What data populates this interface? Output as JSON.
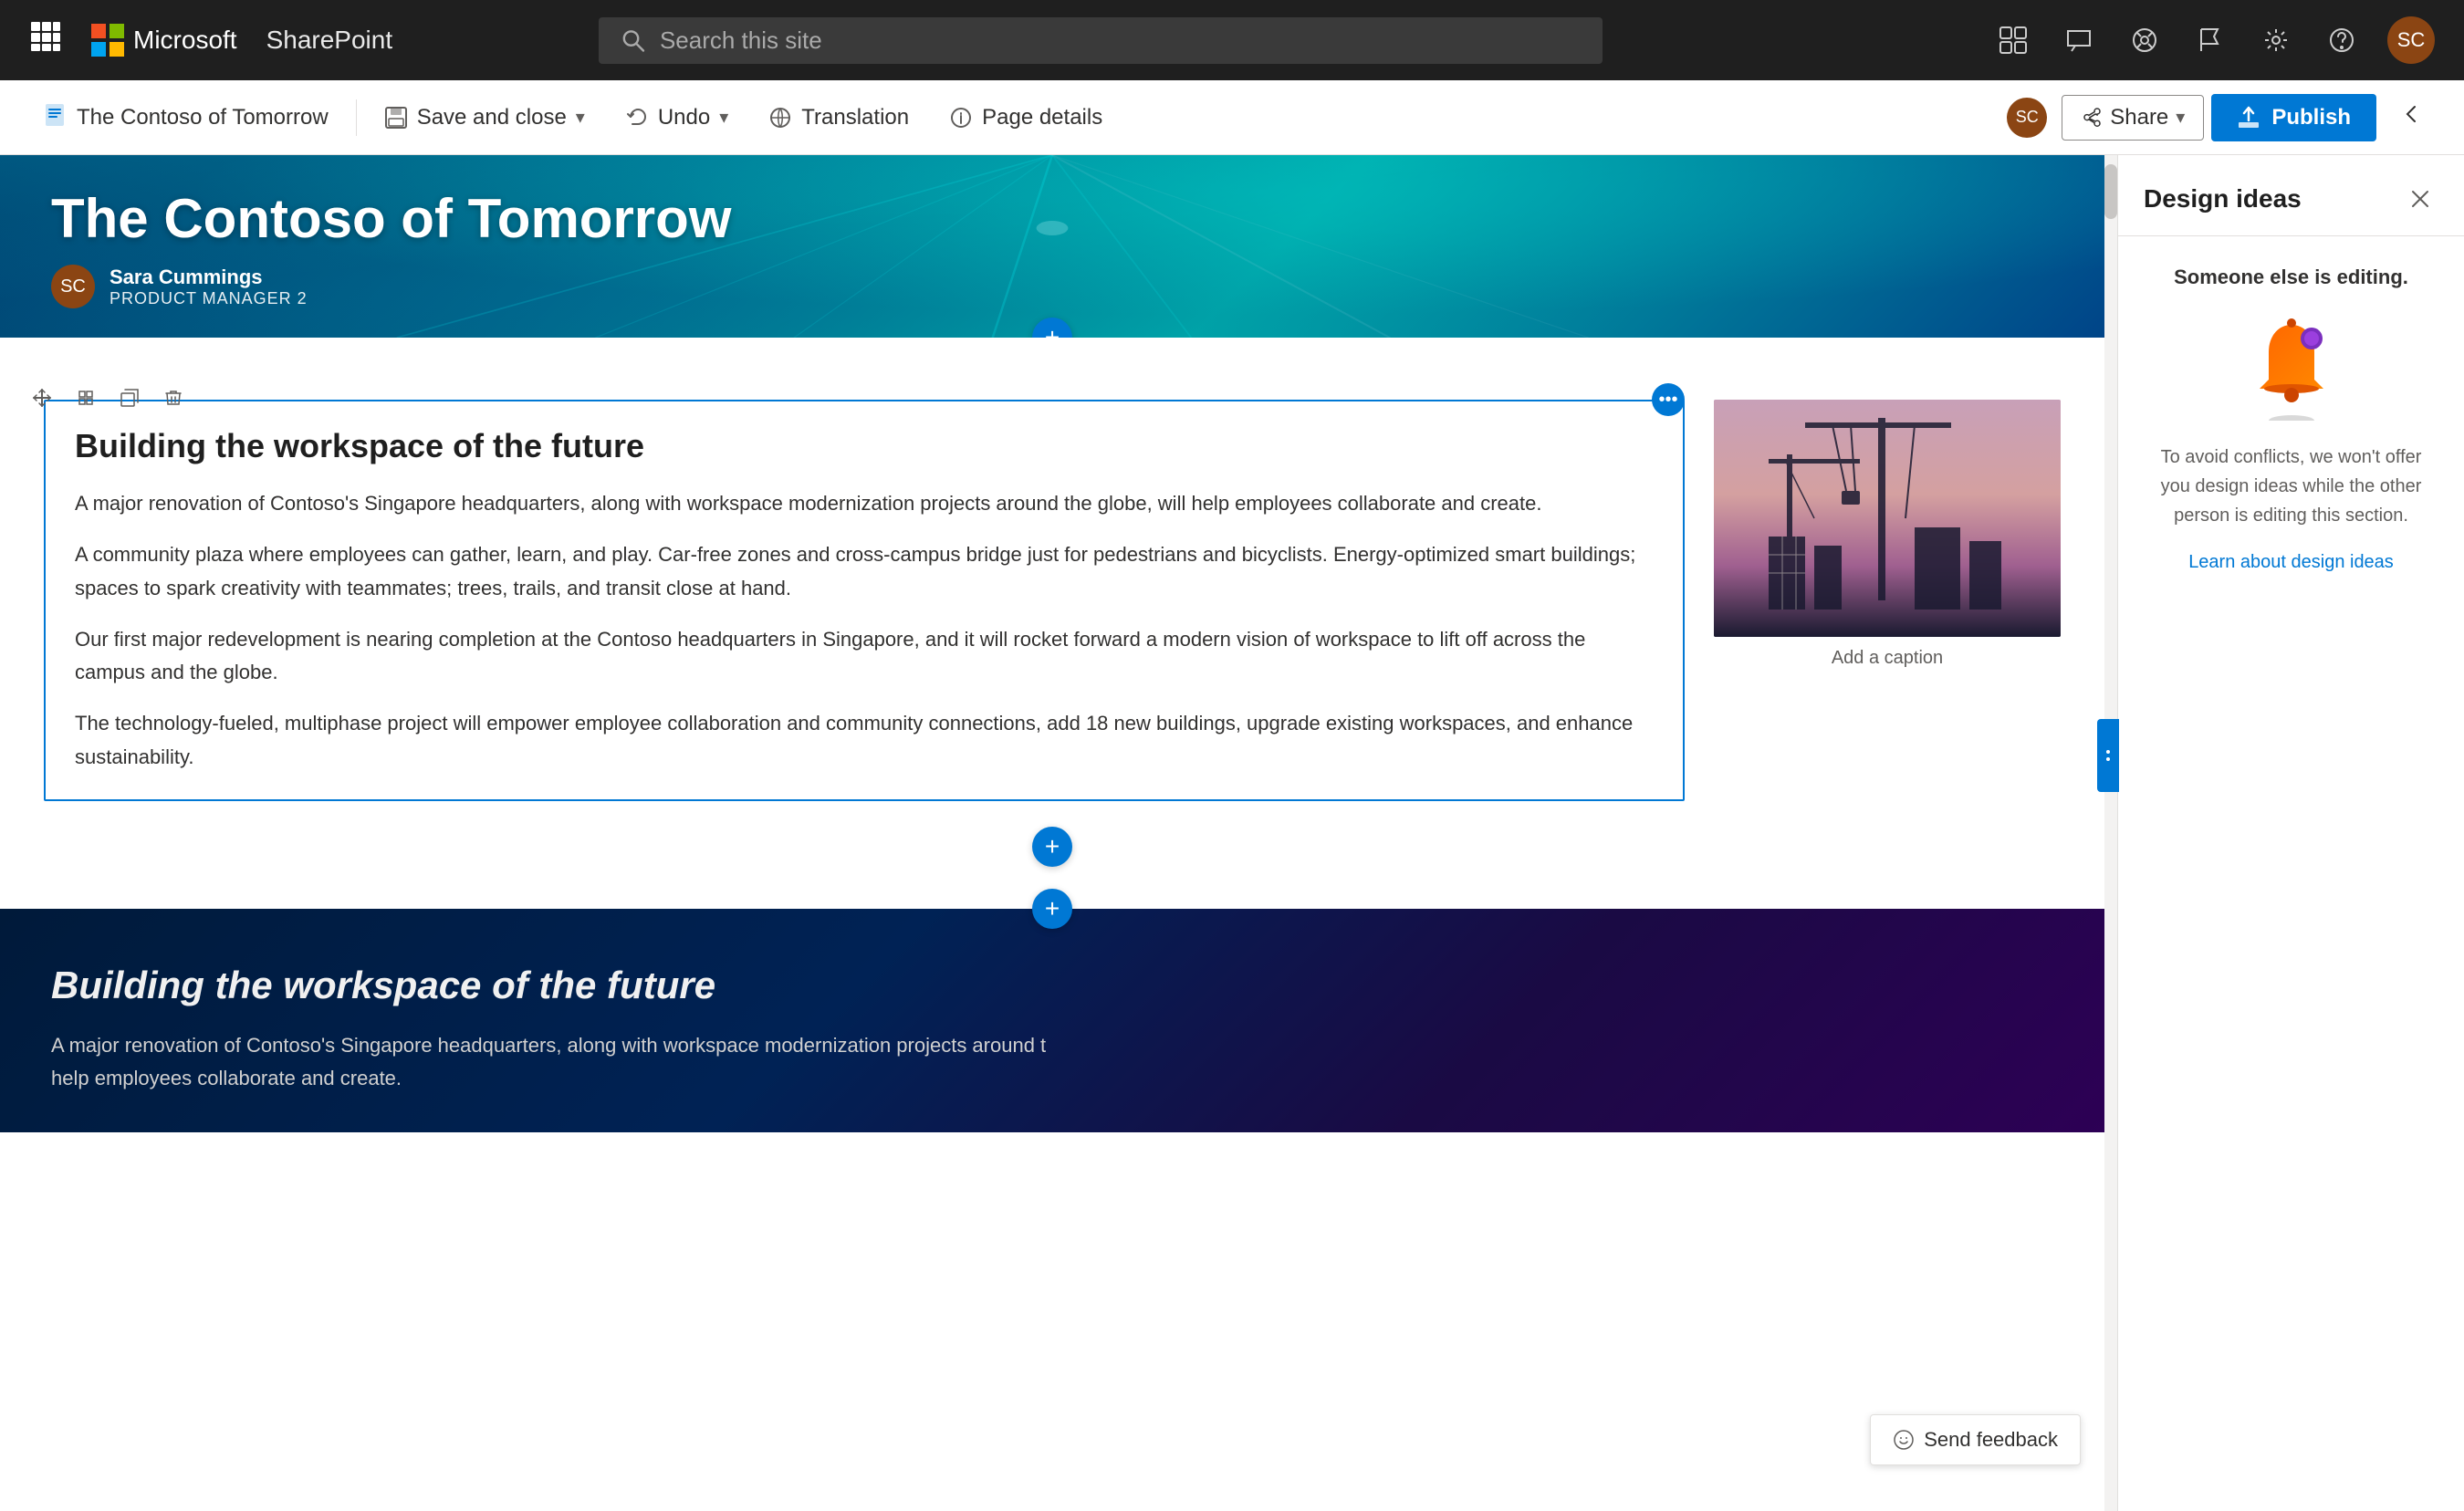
{
  "app": {
    "name": "Microsoft",
    "product": "SharePoint"
  },
  "search": {
    "placeholder": "Search this site"
  },
  "toolbar": {
    "page_label": "The Contoso of Tomorrow",
    "save_close_label": "Save and close",
    "undo_label": "Undo",
    "translation_label": "Translation",
    "page_details_label": "Page details",
    "share_label": "Share",
    "publish_label": "Publish"
  },
  "hero": {
    "title": "The Contoso of Tomorrow",
    "author_name": "Sara Cummings",
    "author_role": "PRODUCT MANAGER 2",
    "avatar_initials": "SC"
  },
  "content": {
    "section1": {
      "heading": "Building the workspace of the future",
      "paragraph1": "A major renovation of Contoso's Singapore headquarters, along with workspace modernization projects around the globe, will help employees collaborate and create.",
      "paragraph2": "A community plaza where employees can gather, learn, and play. Car-free zones and cross-campus bridge just for pedestrians and bicyclists. Energy-optimized smart buildings; spaces to spark creativity with teammates; trees, trails, and transit close at hand.",
      "paragraph3": "Our first major redevelopment is nearing completion at the Contoso headquarters in Singapore, and it will rocket forward a modern vision of workspace to lift off across the campus and the globe.",
      "paragraph4": "The technology-fueled, multiphase project will empower employee collaboration and community connections, add 18 new buildings, upgrade existing workspaces, and enhance sustainability.",
      "image_caption": "Add a caption"
    },
    "section2": {
      "heading": "Building the workspace of the future",
      "paragraph1": "A major renovation of Contoso's Singapore headquarters, along with workspace modernization projects around t",
      "paragraph2": "help employees collaborate and create."
    }
  },
  "design_panel": {
    "title": "Design ideas",
    "subtitle": "Someone else is editing.",
    "description": "To avoid conflicts, we won't offer you design ideas while the other person is editing this section.",
    "link_text": "Learn about design ideas"
  },
  "feedback": {
    "label": "Send feedback"
  },
  "nav_icons": {
    "apps": "⊞",
    "search": "🔍",
    "help": "?",
    "settings": "⚙",
    "flag": "⚑",
    "chat": "💬",
    "person": "👤",
    "puzzle": "🧩",
    "network": "◎"
  }
}
